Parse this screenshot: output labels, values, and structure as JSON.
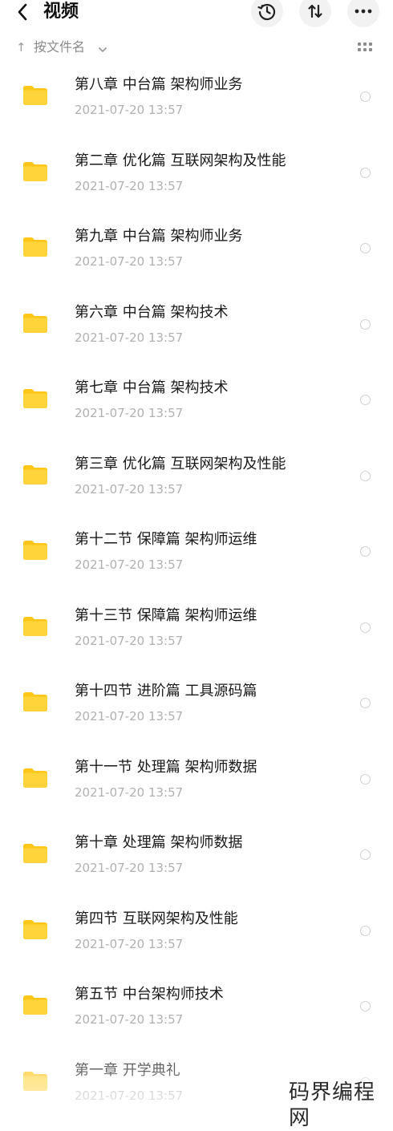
{
  "header": {
    "back_icon": "chevron-left-icon",
    "title": "视频",
    "history_icon": "history-icon",
    "sort_icon": "sort-swap-icon",
    "more_icon": "more-horizontal-icon"
  },
  "sortbar": {
    "arrow": "↑",
    "label": "按文件名",
    "chevron_icon": "chevron-down-icon",
    "view_icon": "grid-view-icon"
  },
  "colors": {
    "folder": "#FFD43B",
    "folder_tab": "#FFC61A",
    "date_text": "#B0B0B0",
    "radio_border": "#CFCFCF"
  },
  "files": [
    {
      "name": "第八章 中台篇 架构师业务",
      "date": "2021-07-20  13:57"
    },
    {
      "name": "第二章 优化篇 互联网架构及性能",
      "date": "2021-07-20  13:57"
    },
    {
      "name": "第九章 中台篇 架构师业务",
      "date": "2021-07-20  13:57"
    },
    {
      "name": "第六章 中台篇 架构技术",
      "date": "2021-07-20  13:57"
    },
    {
      "name": "第七章 中台篇 架构技术",
      "date": "2021-07-20  13:57"
    },
    {
      "name": "第三章 优化篇 互联网架构及性能",
      "date": "2021-07-20  13:57"
    },
    {
      "name": "第十二节 保障篇 架构师运维",
      "date": "2021-07-20  13:57"
    },
    {
      "name": "第十三节 保障篇 架构师运维",
      "date": "2021-07-20  13:57"
    },
    {
      "name": "第十四节 进阶篇 工具源码篇",
      "date": "2021-07-20  13:57"
    },
    {
      "name": "第十一节 处理篇 架构师数据",
      "date": "2021-07-20  13:57"
    },
    {
      "name": "第十章 处理篇 架构师数据",
      "date": "2021-07-20  13:57"
    },
    {
      "name": "第四节 互联网架构及性能",
      "date": "2021-07-20  13:57"
    },
    {
      "name": "第五节  中台架构师技术",
      "date": "2021-07-20  13:57"
    },
    {
      "name": "第一章 开学典礼",
      "date": "2021-07-20  13:57"
    }
  ],
  "watermark": "码界编程网"
}
